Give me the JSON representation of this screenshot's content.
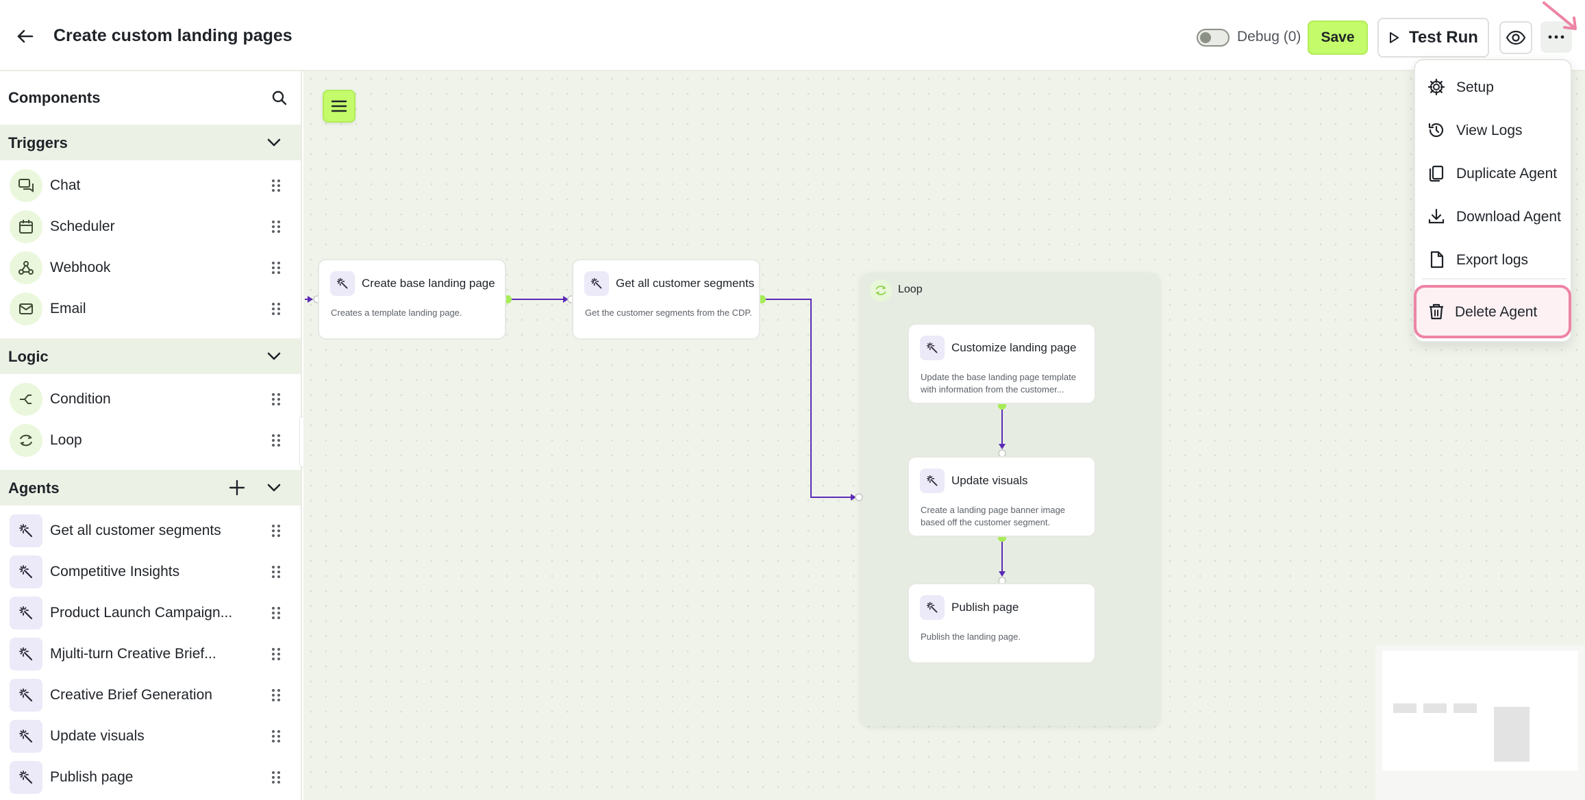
{
  "header": {
    "title": "Create custom landing pages",
    "debug_label": "Debug (0)",
    "save_label": "Save",
    "test_run_label": "Test Run"
  },
  "sidebar": {
    "title": "Components",
    "sections": {
      "triggers": {
        "label": "Triggers",
        "items": [
          "Chat",
          "Scheduler",
          "Webhook",
          "Email"
        ]
      },
      "logic": {
        "label": "Logic",
        "items": [
          "Condition",
          "Loop"
        ]
      },
      "agents": {
        "label": "Agents",
        "items": [
          "Get all customer segments",
          "Competitive Insights",
          "Product Launch Campaign...",
          "Mjulti-turn Creative Brief...",
          "Creative Brief Generation",
          "Update visuals",
          "Publish page"
        ]
      }
    }
  },
  "canvas": {
    "nodes": [
      {
        "title": "Create base landing page",
        "desc": "Creates a template landing page."
      },
      {
        "title": "Get all customer segments",
        "desc": "Get the customer segments from the CDP."
      },
      {
        "title": "Customize landing page",
        "desc": "Update the base landing page template with information from the customer..."
      },
      {
        "title": "Update visuals",
        "desc": "Create a landing page banner image based off the customer segment."
      },
      {
        "title": "Publish page",
        "desc": "Publish the landing page."
      }
    ],
    "loop_label": "Loop"
  },
  "menu": {
    "items": [
      "Setup",
      "View Logs",
      "Duplicate Agent",
      "Download Agent",
      "Export logs"
    ],
    "delete_label": "Delete Agent"
  },
  "colors": {
    "accent_green": "#c3fb6b",
    "wire_purple": "#5b2bb5",
    "delete_highlight": "#ee84a5"
  }
}
